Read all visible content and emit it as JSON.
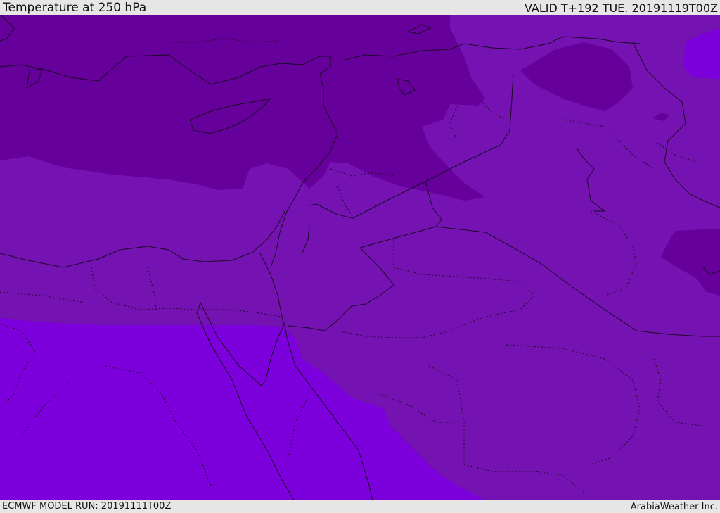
{
  "header": {
    "title": "Temperature at 250 hPa",
    "valid": "VALID T+192 TUE. 20191119T00Z"
  },
  "footer": {
    "model_run": "ECMWF MODEL RUN: 20191111T00Z",
    "credit": "ArabiaWeather Inc."
  },
  "map": {
    "field": "temperature-250hPa",
    "colors": {
      "coldest": "#66009a",
      "mid": "#7512b2",
      "warm": "#7c00dc",
      "lines": "#1a0a24"
    }
  }
}
